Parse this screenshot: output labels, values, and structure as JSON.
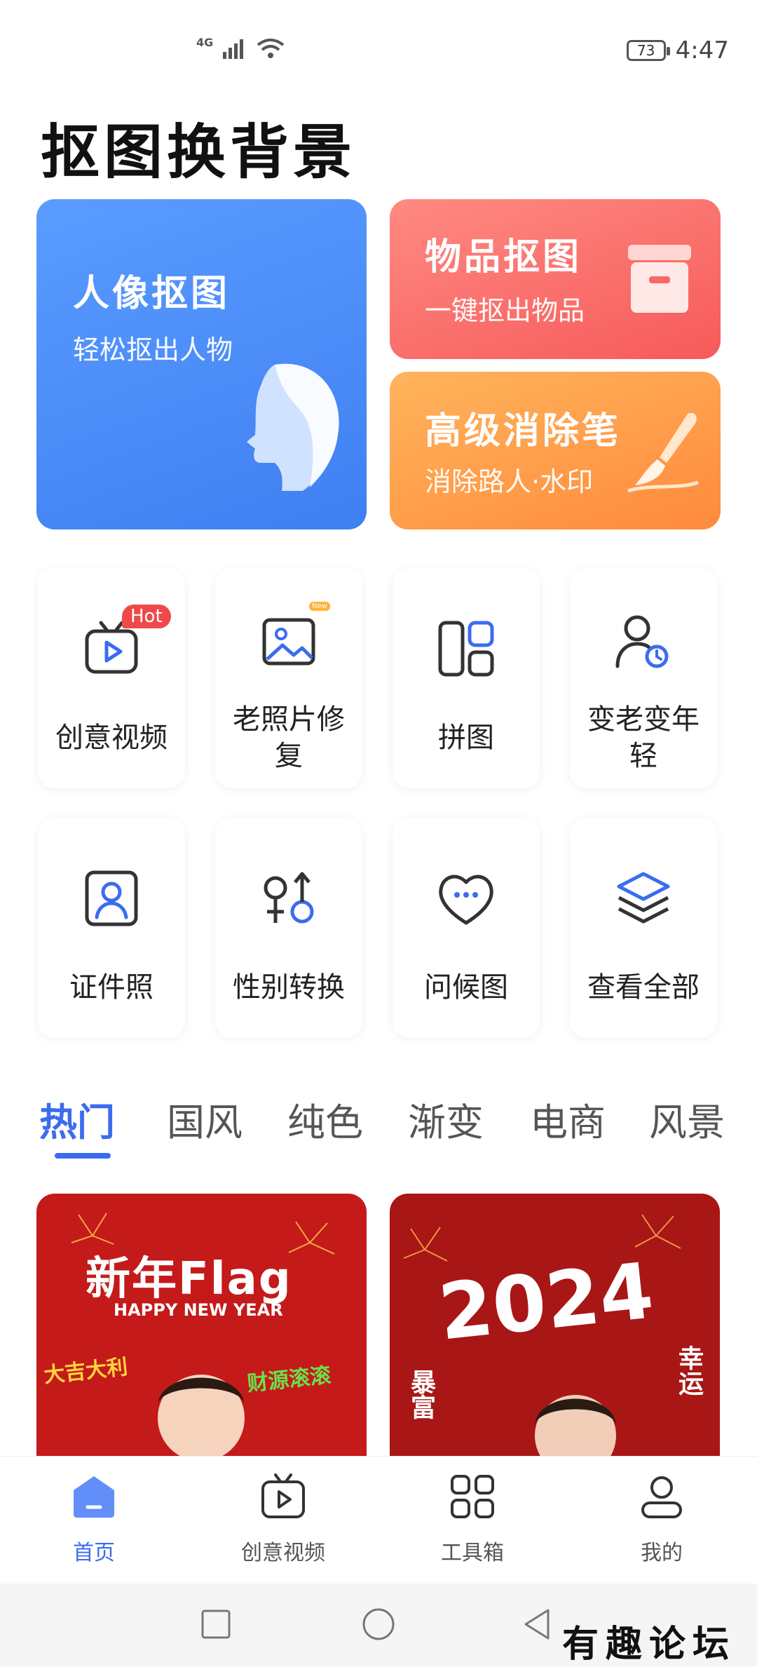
{
  "status_bar": {
    "network": "4G",
    "battery": "73",
    "time": "4:47"
  },
  "app_title": "抠图换背景",
  "feature_cards": {
    "portrait": {
      "title": "人像抠图",
      "subtitle": "轻松抠出人物"
    },
    "object": {
      "title": "物品抠图",
      "subtitle": "一键抠出物品"
    },
    "eraser": {
      "title": "高级消除笔",
      "subtitle": "消除路人·水印"
    }
  },
  "tools": [
    {
      "label": "创意视频",
      "badge": "Hot",
      "icon": "tv-play-icon"
    },
    {
      "label": "老照片修复",
      "badge": "New",
      "icon": "photo-icon"
    },
    {
      "label": "拼图",
      "icon": "collage-icon"
    },
    {
      "label": "变老变年轻",
      "icon": "user-clock-icon"
    },
    {
      "label": "证件照",
      "icon": "id-photo-icon"
    },
    {
      "label": "性别转换",
      "icon": "gender-swap-icon"
    },
    {
      "label": "问候图",
      "icon": "heart-chat-icon"
    },
    {
      "label": "查看全部",
      "icon": "layers-icon"
    }
  ],
  "category_tabs": [
    "热门",
    "国风",
    "纯色",
    "渐变",
    "电商",
    "风景"
  ],
  "active_tab": "热门",
  "templates": [
    {
      "title": "新年Flag",
      "subtitle": "HAPPY NEW YEAR",
      "tag_left": "大吉大利",
      "tag_right": "财源滚滚"
    },
    {
      "title": "2024",
      "tag_left": "暴富",
      "tag_right": "幸运"
    }
  ],
  "bottom_nav": [
    {
      "label": "首页",
      "icon": "home-icon",
      "active": true
    },
    {
      "label": "创意视频",
      "icon": "tv-play-icon"
    },
    {
      "label": "工具箱",
      "icon": "grid-icon"
    },
    {
      "label": "我的",
      "icon": "user-icon"
    }
  ],
  "watermark": "有趣论坛",
  "colors": {
    "accent": "#3b6cf0",
    "portrait_card": "#4a8cf7",
    "object_card": "#f76a66",
    "eraser_card": "#ff9a48",
    "hot_badge": "#ee4a4a"
  }
}
